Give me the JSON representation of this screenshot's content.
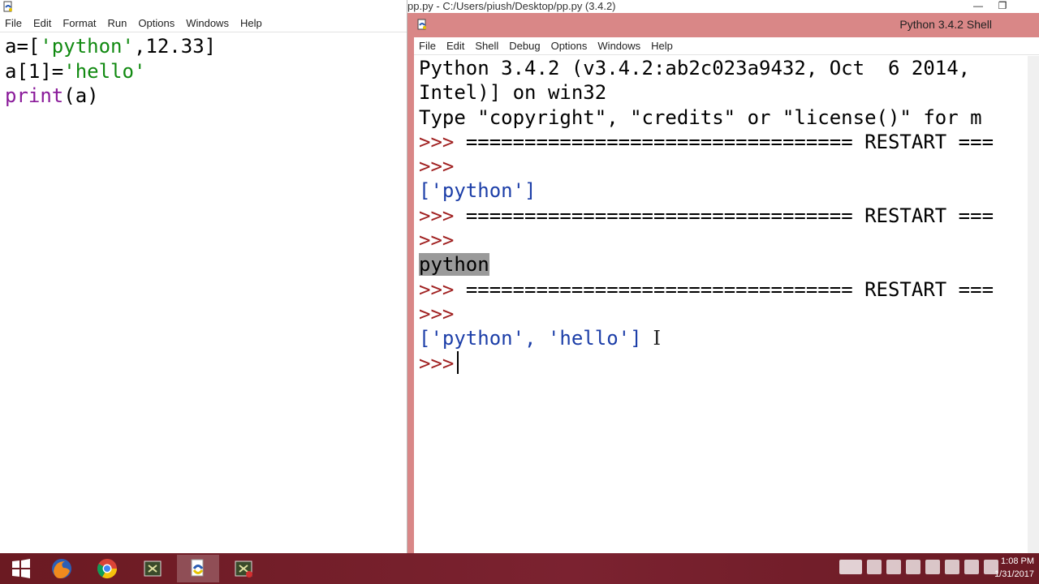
{
  "editor": {
    "menu": [
      "File",
      "Edit",
      "Format",
      "Run",
      "Options",
      "Windows",
      "Help"
    ],
    "lines": [
      {
        "a": "a=[",
        "s1": "'python'",
        "b": ",12.33]"
      },
      {
        "a": "a[1]=",
        "s1": "'hello'",
        "b": ""
      },
      {
        "kw": "print",
        "b": "(a)"
      }
    ]
  },
  "shell": {
    "window_title": "pp.py - C:/Users/piush/Desktop/pp.py (3.4.2)",
    "title": "Python 3.4.2 Shell",
    "menu": [
      "File",
      "Edit",
      "Shell",
      "Debug",
      "Options",
      "Windows",
      "Help"
    ],
    "banner1": "Python 3.4.2 (v3.4.2:ab2c023a9432, Oct  6 2014,",
    "banner2": "Intel)] on win32",
    "banner3": "Type \"copyright\", \"credits\" or \"license()\" for m",
    "prompt": ">>>",
    "restart": "================================= RESTART ===",
    "out1": "['python']",
    "out2": "python",
    "out3": "['python', 'hello']"
  },
  "taskbar": {
    "time": "1:08 PM",
    "date": "1/31/2017",
    "icons": [
      "windows-start-icon",
      "firefox-icon",
      "chrome-icon",
      "idle-icon",
      "python-icon",
      "idle-icon"
    ]
  }
}
